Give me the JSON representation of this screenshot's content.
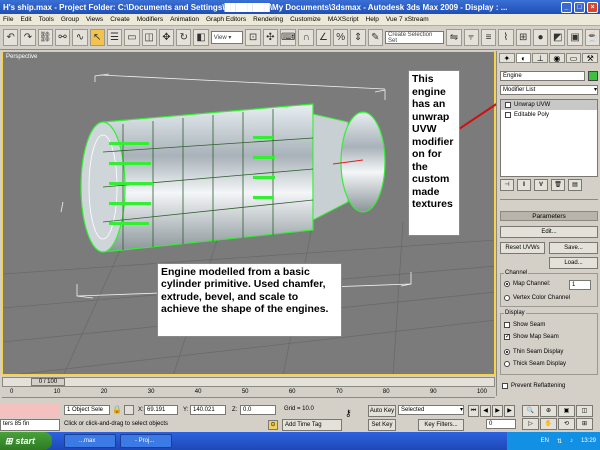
{
  "window": {
    "title": "H's ship.max    - Project Folder: C:\\Documents and Settings\\████████\\My Documents\\3dsmax    - Autodesk 3ds Max  2009         - Display : ..."
  },
  "menu": [
    "File",
    "Edit",
    "Tools",
    "Group",
    "Views",
    "Create",
    "Modifiers",
    "Animation",
    "Graph Editors",
    "Rendering",
    "Customize",
    "MAXScript",
    "Help",
    "Vue 7 xStream"
  ],
  "toolbar": {
    "view_select": "View",
    "selection_set": "Create Selection Set"
  },
  "viewport": {
    "label": "Perspective"
  },
  "annotations": {
    "modifier_note": "This engine has an unwrap UVW modifier on for the custom made textures",
    "model_note": "Engine modelled from a basic cylinder primitive. Used chamfer, extrude, bevel, and scale to achieve the shape of the engines."
  },
  "command_panel": {
    "object_name": "Engine",
    "modifier_list": "Modifier List",
    "stack": [
      "Unwrap UVW",
      "Editable Poly"
    ],
    "rollout_title": "Parameters",
    "edit_button": "Edit...",
    "reset_button": "Reset UVWs",
    "save_button": "Save...",
    "load_button": "Load...",
    "channel_group": "Channel",
    "map_channel_label": "Map Channel:",
    "map_channel_value": "1",
    "vertex_color_channel": "Vertex Color Channel",
    "display_group": "Display",
    "show_seam": "Show Seam",
    "show_map_seam": "Show Map Seam",
    "thin_seam": "Thin Seam Display",
    "thick_seam": "Thick Seam Display",
    "prevent_reflattening": "Prevent Reflattening"
  },
  "timeline": {
    "frame": "0 / 100",
    "ticks": [
      "0",
      "10",
      "20",
      "30",
      "40",
      "50",
      "60",
      "70",
      "80",
      "90",
      "100"
    ]
  },
  "status": {
    "listener_text": "ters 85 fin",
    "selection_count": "1 Object Sele",
    "x_label": "X:",
    "x_value": "69.191",
    "y_label": "Y:",
    "y_value": "140.021",
    "z_label": "Z:",
    "z_value": "0.0",
    "grid": "Grid = 10.0",
    "auto_key": "Auto Key",
    "key_mode": "Selected",
    "set_key": "Set Key",
    "key_filters": "Key Filters...",
    "frame_value": "0",
    "prompt": "Click or click-and-drag to select objects",
    "add_time_tag": "Add Time Tag"
  },
  "taskbar": {
    "start": "start",
    "tasks": [
      "...max",
      "- Proj..."
    ],
    "lang": "EN",
    "clock": "13:29"
  }
}
